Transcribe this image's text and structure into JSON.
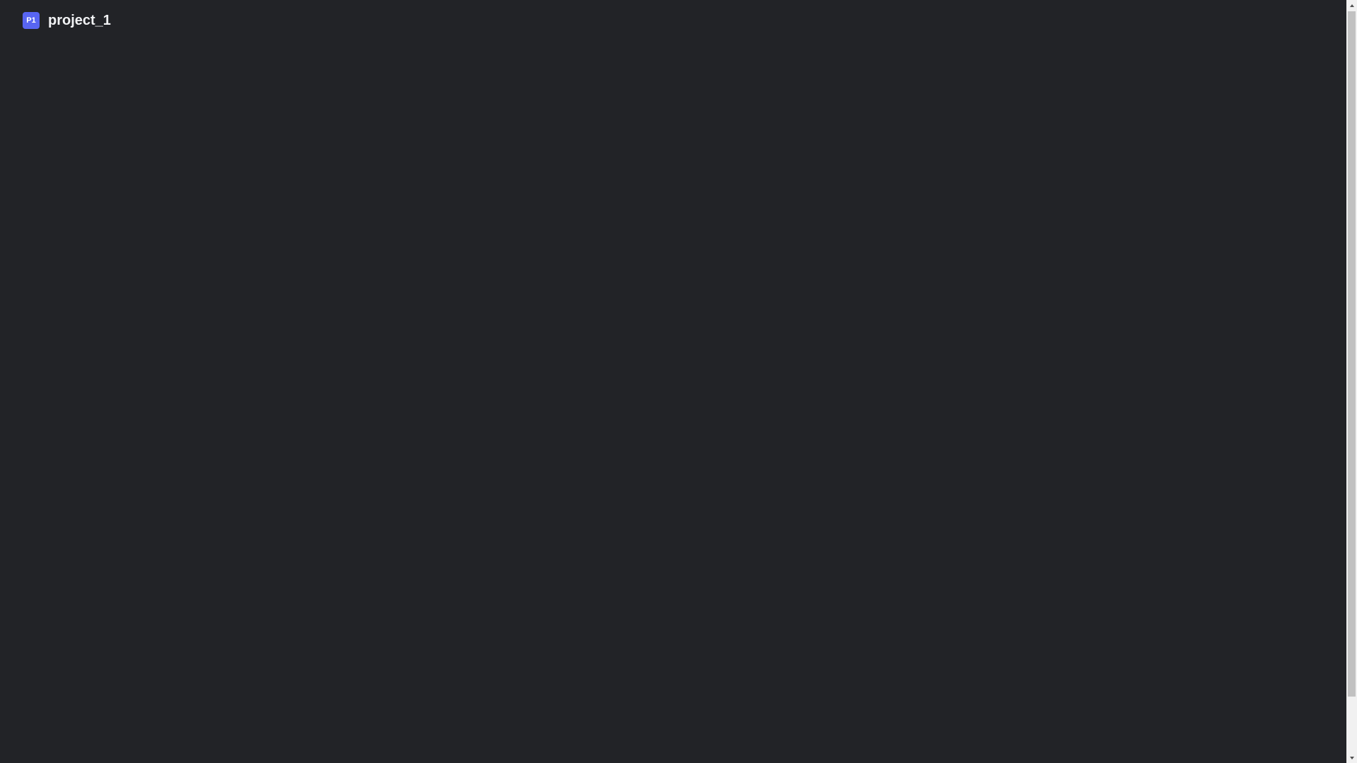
{
  "project": {
    "badge": "P1",
    "title": "project_1",
    "badge_color": "#5865f2"
  },
  "theme": {
    "background": "#222327",
    "title_color": "#f2f3f5"
  },
  "scrollbar": {
    "up_icon": "chevron-up-icon",
    "down_icon": "chevron-down-icon"
  }
}
